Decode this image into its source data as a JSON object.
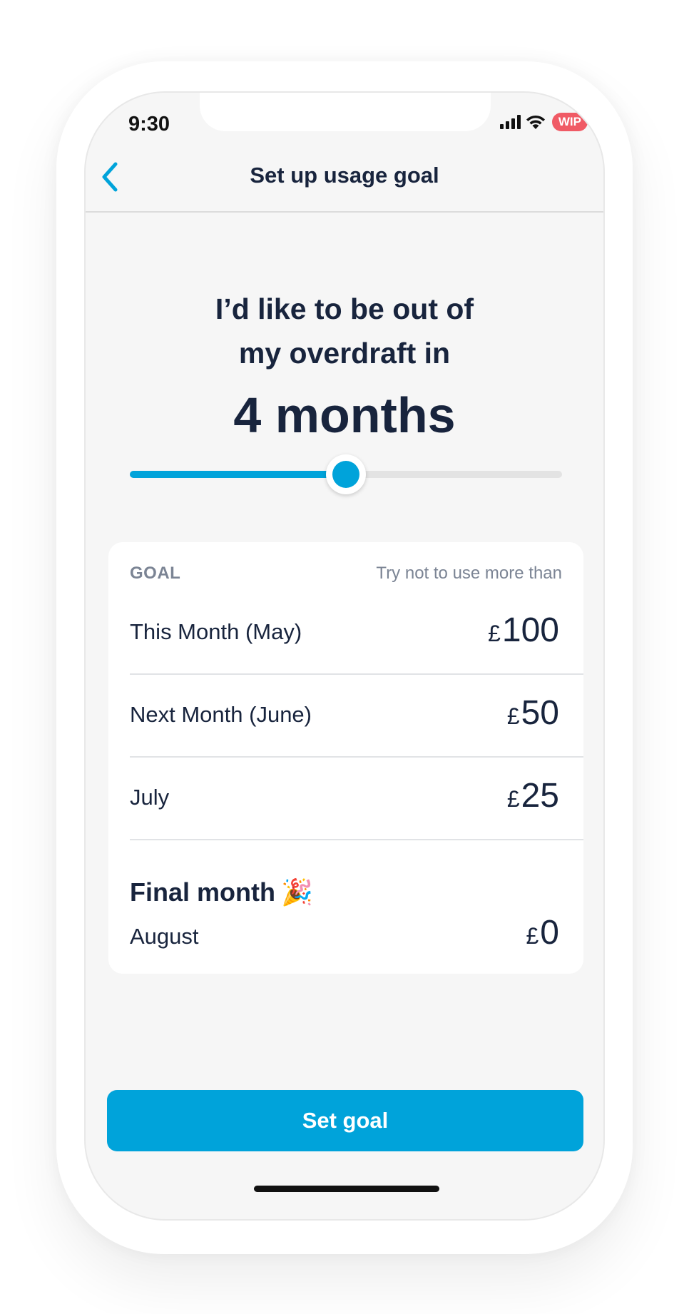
{
  "status_bar": {
    "time": "9:30",
    "badge": "WIP"
  },
  "nav": {
    "back_icon": "chevron-left-icon",
    "title": "Set up usage goal"
  },
  "headline": {
    "line1": "I’d like to be out of",
    "line2": "my overdraft in",
    "duration": "4 months"
  },
  "slider": {
    "value_fraction": 0.5
  },
  "goal_card": {
    "header_left": "GOAL",
    "header_right": "Try not to use more than",
    "rows": [
      {
        "label": "This Month (May)",
        "currency": "£",
        "amount": "100"
      },
      {
        "label": "Next Month (June)",
        "currency": "£",
        "amount": "50"
      },
      {
        "label": "July",
        "currency": "£",
        "amount": "25"
      }
    ],
    "final": {
      "title": "Final month",
      "emoji": "🎉",
      "label": "August",
      "currency": "£",
      "amount": "0"
    }
  },
  "cta": {
    "label": "Set goal"
  },
  "colors": {
    "accent": "#00a3da",
    "text": "#18243d",
    "muted": "#7b8494",
    "badge": "#f05a65"
  }
}
